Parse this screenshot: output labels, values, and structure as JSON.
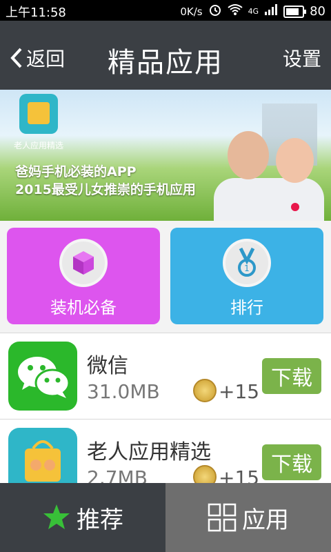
{
  "status_bar": {
    "time": "上午11:58",
    "data_rate": "0K/s",
    "network": "4G",
    "battery": "80"
  },
  "header": {
    "back_label": "返回",
    "title": "精品应用",
    "settings_label": "设置"
  },
  "banner": {
    "app_label": "老人应用精选",
    "line1": "爸妈手机必装的APP",
    "line2": "2015最受儿女推崇的手机应用"
  },
  "tiles": [
    {
      "label": "装机必备",
      "color": "#dd55ee",
      "icon": "box-icon"
    },
    {
      "label": "排行",
      "color": "#3cb2e6",
      "icon": "medal-icon"
    }
  ],
  "apps": [
    {
      "name": "微信",
      "size": "31.0MB",
      "points": "+15",
      "download_label": "下载",
      "icon": "wechat-icon"
    },
    {
      "name": "老人应用精选",
      "size": "2.7MB",
      "points": "+15",
      "download_label": "下载",
      "icon": "elderly-app-icon"
    }
  ],
  "bottom_nav": {
    "recommend_label": "推荐",
    "apps_label": "应用"
  },
  "colors": {
    "header_bg": "#3b3f44",
    "download_green": "#7bb34a",
    "active_tab_star": "#38c038"
  }
}
